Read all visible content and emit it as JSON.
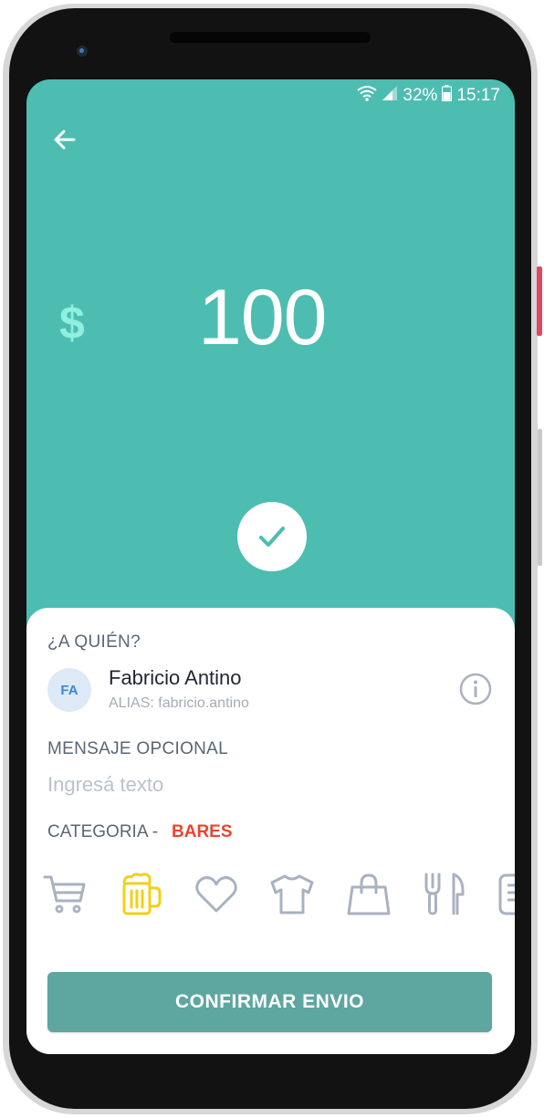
{
  "status_bar": {
    "battery": "32%",
    "time": "15:17"
  },
  "payment": {
    "currency_symbol": "$",
    "amount": "100"
  },
  "recipient": {
    "section_label": "¿A QUIÉN?",
    "initials": "FA",
    "name": "Fabricio Antino",
    "alias": "ALIAS: fabricio.antino"
  },
  "message": {
    "label": "MENSAJE OPCIONAL",
    "placeholder": "Ingresá texto",
    "value": ""
  },
  "category": {
    "label": "CATEGORIA -",
    "selected": "BARES",
    "icons": [
      "cart-icon",
      "beer-icon",
      "heart-icon",
      "shirt-icon",
      "shopping-bag-icon",
      "fork-knife-icon",
      "receipt-icon"
    ]
  },
  "cta": {
    "label": "CONFIRMAR ENVIO"
  },
  "colors": {
    "primary": "#4dbdb1",
    "accent_red": "#e8452f",
    "selected_icon": "#f2d016",
    "icon_default": "#a9b2bf",
    "button": "#5ea6a0"
  }
}
